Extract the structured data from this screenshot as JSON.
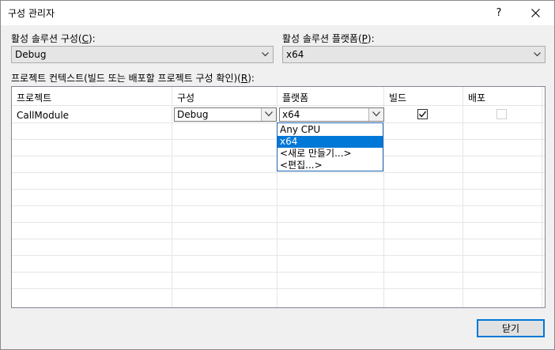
{
  "window": {
    "title": "구성 관리자",
    "help": "?"
  },
  "solution_config": {
    "label": "활성 솔루션 구성(",
    "key": "C",
    "label_end": "):",
    "value": "Debug"
  },
  "solution_platform": {
    "label": "활성 솔루션 플랫폼(",
    "key": "P",
    "label_end": "):",
    "value": "x64"
  },
  "contexts": {
    "label": "프로젝트 컨텍스트(빌드 또는 배포할 프로젝트 구성 확인)(",
    "key": "R",
    "label_end": "):"
  },
  "grid": {
    "columns": [
      "프로젝트",
      "구성",
      "플랫폼",
      "빌드",
      "배포"
    ],
    "rows": [
      {
        "project": "CallModule",
        "config": "Debug",
        "platform": "x64",
        "build": true,
        "deploy": false
      }
    ]
  },
  "platform_dropdown": {
    "options": [
      "Any CPU",
      "x64",
      "<새로 만들기...>",
      "<편집...>"
    ],
    "selected": "x64"
  },
  "buttons": {
    "close": "닫기"
  }
}
